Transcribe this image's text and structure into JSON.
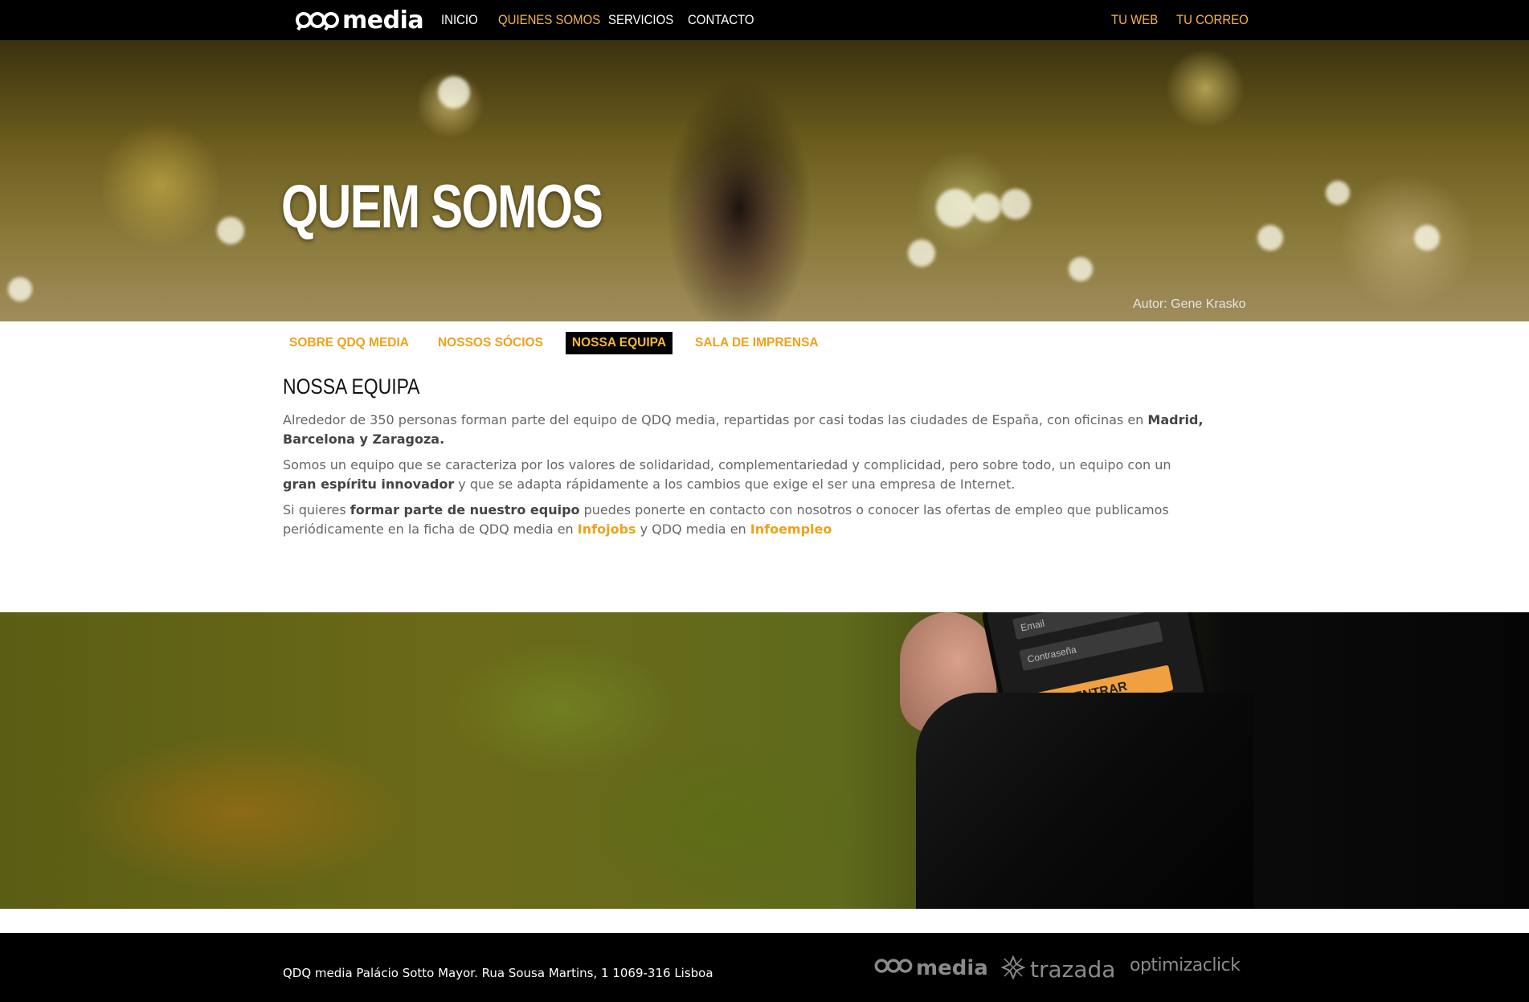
{
  "header": {
    "logo_text": "media",
    "nav": [
      "INICIO",
      "QUIENES SOMOS",
      "SERVICIOS",
      "CONTACTO"
    ],
    "nav_right": [
      "TU WEB",
      "TU CORREO"
    ]
  },
  "hero": {
    "title": "QUEM SOMOS",
    "credit": "Autor: Gene Krasko"
  },
  "subtabs": [
    "SOBRE QDQ MEDIA",
    "NOSSOS SÓCIOS",
    "NOSSA EQUIPA",
    "SALA DE IMPRENSA"
  ],
  "content": {
    "heading": "NOSSA EQUIPA",
    "p1_a": "Alrededor de 350 personas forman parte del equipo de QDQ media, repartidas por casi todas las ciudades de España, con oficinas en ",
    "p1_b": "Madrid, Barcelona y Zaragoza.",
    "p2_a": "Somos un equipo que se caracteriza por los valores de solidaridad, complementariedad y complicidad, pero sobre todo, un equipo con un ",
    "p2_b": "gran espíritu innovador",
    "p2_c": " y que se adapta rápidamente a los cambios que exige el ser una empresa de Internet.",
    "p3_a": "Si quieres ",
    "p3_b": "formar parte de nuestro equipo",
    "p3_c": " puedes ponerte en contacto con nosotros o conocer las ofertas de empleo que publicamos periódicamente en la ficha de QDQ media en ",
    "p3_link1": "Infojobs",
    "p3_d": " y QDQ media en ",
    "p3_link2": "Infoempleo"
  },
  "phone": {
    "email_placeholder": "Email",
    "password_placeholder": "Contraseña",
    "button": "ENTRAR"
  },
  "footer": {
    "address": "QDQ media Palácio Sotto Mayor. Rua Sousa Martins, 1 1069-316 Lisboa",
    "logos": [
      "media",
      "trazada",
      "optimizaclick"
    ]
  },
  "colors": {
    "accent": "#f0a11b",
    "accent_light": "#f7b742",
    "bar": "#000000"
  }
}
